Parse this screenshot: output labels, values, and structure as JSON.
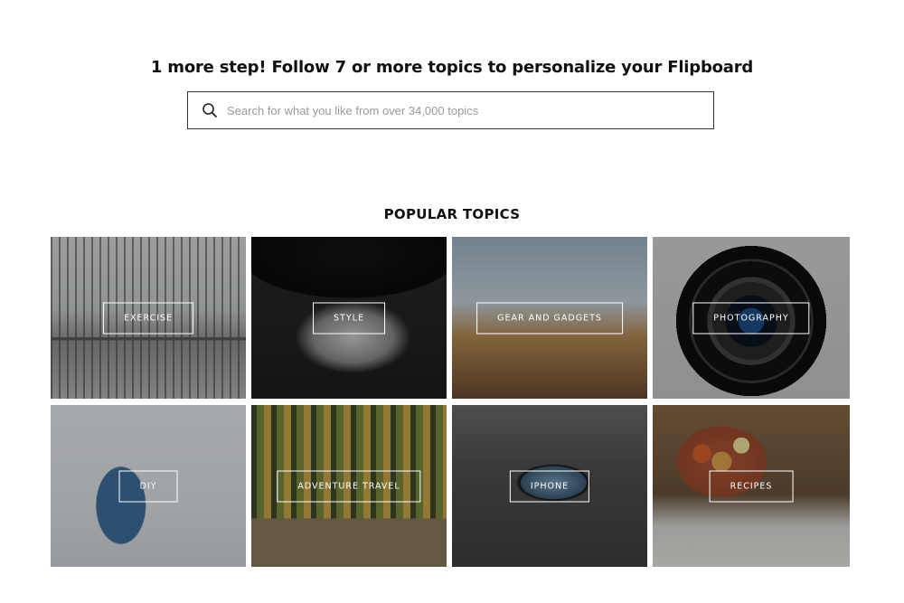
{
  "header": {
    "headline": "1 more step! Follow 7 or more topics to personalize your Flipboard"
  },
  "search": {
    "icon": "search-icon",
    "placeholder": "Search for what you like from over 34,000 topics"
  },
  "popular": {
    "title": "POPULAR TOPICS",
    "topics": [
      {
        "label": "EXERCISE"
      },
      {
        "label": "STYLE"
      },
      {
        "label": "GEAR AND GADGETS"
      },
      {
        "label": "PHOTOGRAPHY"
      },
      {
        "label": "DIY"
      },
      {
        "label": "ADVENTURE TRAVEL"
      },
      {
        "label": "IPHONE"
      },
      {
        "label": "RECIPES"
      }
    ]
  }
}
